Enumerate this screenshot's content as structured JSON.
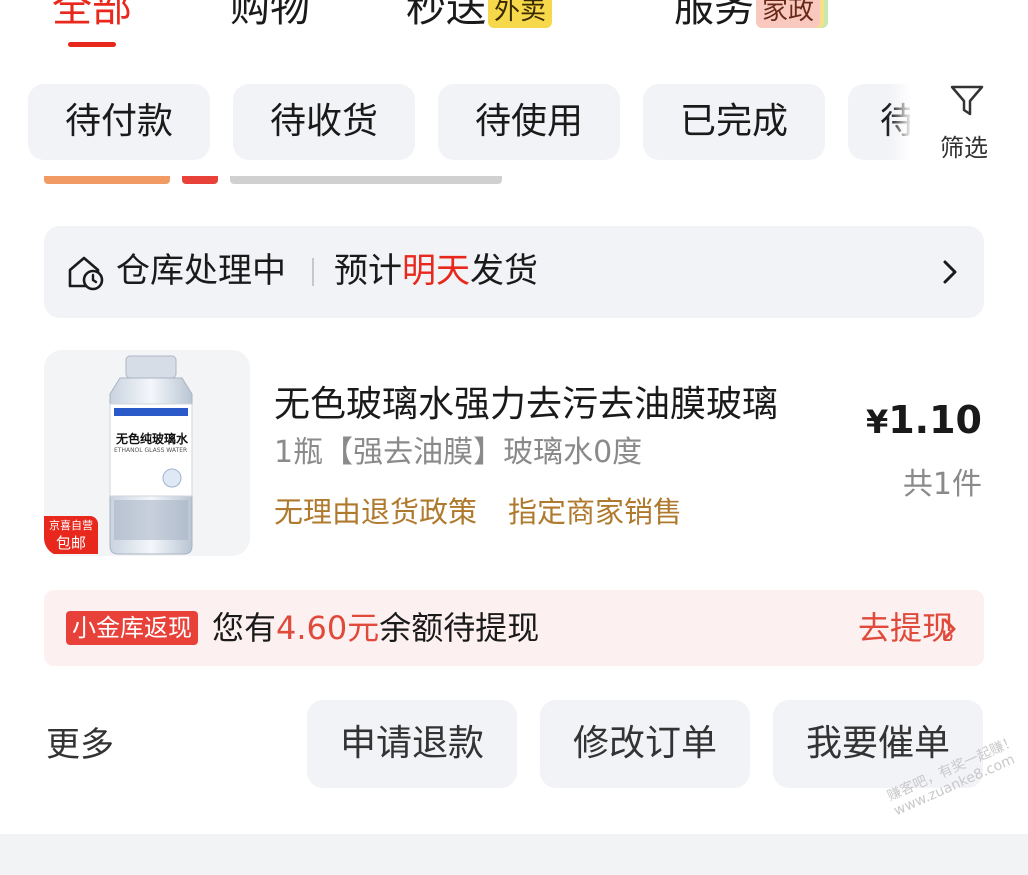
{
  "tabs": [
    {
      "label": "全部",
      "active": true
    },
    {
      "label": "购物"
    },
    {
      "label": "秒送",
      "badge": "外卖"
    },
    {
      "label": "服务",
      "badge": "家政"
    }
  ],
  "status_chips": [
    "待付款",
    "待收货",
    "待使用",
    "已完成",
    "待"
  ],
  "filter": {
    "label": "筛选",
    "icon": "funnel-icon"
  },
  "warehouse": {
    "icon": "warehouse-clock-icon",
    "status": "仓库处理中",
    "eta_prefix": "预计",
    "eta_highlight": "明天",
    "eta_suffix": "发货"
  },
  "product": {
    "image_label_brand": "无色纯玻璃水",
    "image_label_en": "ETHANOL GLASS WATER",
    "image_badge_top": "京喜自营",
    "image_badge_bottom": "包邮",
    "title": "无色玻璃水强力去污去油膜玻璃",
    "spec": "1瓶【强去油膜】玻璃水0度",
    "tags": [
      "无理由退货政策",
      "指定商家销售"
    ],
    "price_symbol": "¥",
    "price_value": "1.10",
    "quantity": "共1件"
  },
  "cashback": {
    "badge": "小金库返现",
    "text_prefix": "您有",
    "amount": "4.60元",
    "text_suffix": "余额待提现",
    "link": "去提现"
  },
  "actions": {
    "more": "更多",
    "buttons": [
      "申请退款",
      "修改订单",
      "我要催单"
    ]
  },
  "watermark": [
    "赚客吧，有奖一起赚！",
    "www.zuanke8.com"
  ],
  "colors": {
    "accent": "#e8281c",
    "tag_gold": "#b07a2e",
    "chip_bg": "#f2f3f7"
  }
}
